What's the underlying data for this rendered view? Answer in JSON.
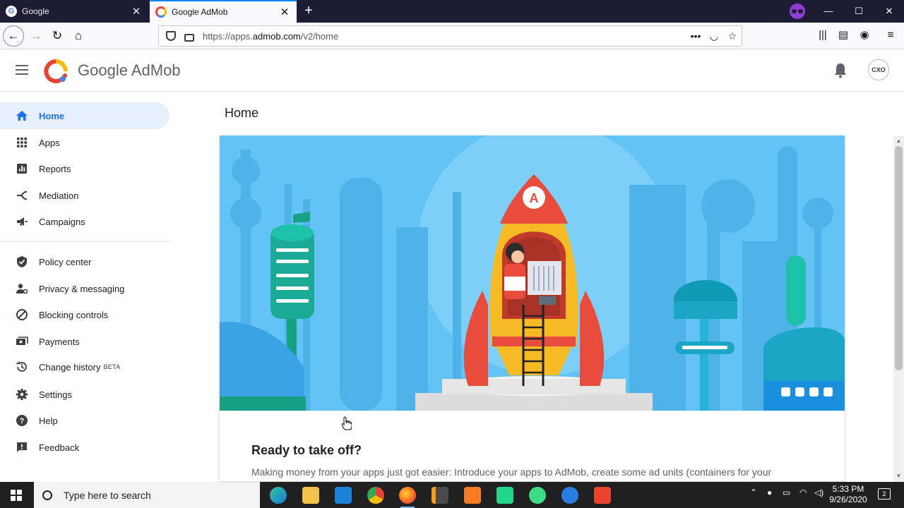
{
  "browser": {
    "tabs": [
      {
        "title": "Google",
        "active": false
      },
      {
        "title": "Google AdMob",
        "active": true
      }
    ],
    "url_prefix": "https://apps.",
    "url_domain": "admob.com",
    "url_path": "/v2/home",
    "url_actions": "•••",
    "new_tab": "+",
    "window": {
      "minimize": "—",
      "maximize": "☐",
      "close": "✕"
    }
  },
  "header": {
    "brand": "Google AdMob",
    "avatar_text": "CXO"
  },
  "sidebar": {
    "items": [
      {
        "label": "Home",
        "icon": "home-icon",
        "active": true
      },
      {
        "label": "Apps",
        "icon": "apps-grid-icon"
      },
      {
        "label": "Reports",
        "icon": "reports-icon"
      },
      {
        "label": "Mediation",
        "icon": "mediation-icon"
      },
      {
        "label": "Campaigns",
        "icon": "megaphone-icon"
      },
      {
        "label": "Policy center",
        "icon": "shield-check-icon"
      },
      {
        "label": "Privacy & messaging",
        "icon": "person-settings-icon"
      },
      {
        "label": "Blocking controls",
        "icon": "block-icon"
      },
      {
        "label": "Payments",
        "icon": "payments-icon"
      },
      {
        "label": "Change history",
        "icon": "history-icon",
        "badge": "BETA"
      },
      {
        "label": "Settings",
        "icon": "gear-icon"
      },
      {
        "label": "Help",
        "icon": "help-icon"
      },
      {
        "label": "Feedback",
        "icon": "feedback-icon"
      }
    ]
  },
  "main": {
    "title": "Home",
    "card": {
      "heading": "Ready to take off?",
      "body": "Making money from your apps just got easier: Introduce your apps to AdMob, create some ad units (containers for your"
    }
  },
  "taskbar": {
    "search_placeholder": "Type here to search",
    "time": "5:33 PM",
    "date": "9/26/2020",
    "notifications": "2"
  },
  "colors": {
    "accent": "#1a73e8",
    "active_bg": "#e8f0fe",
    "hero_sky": "#64c3f5"
  }
}
